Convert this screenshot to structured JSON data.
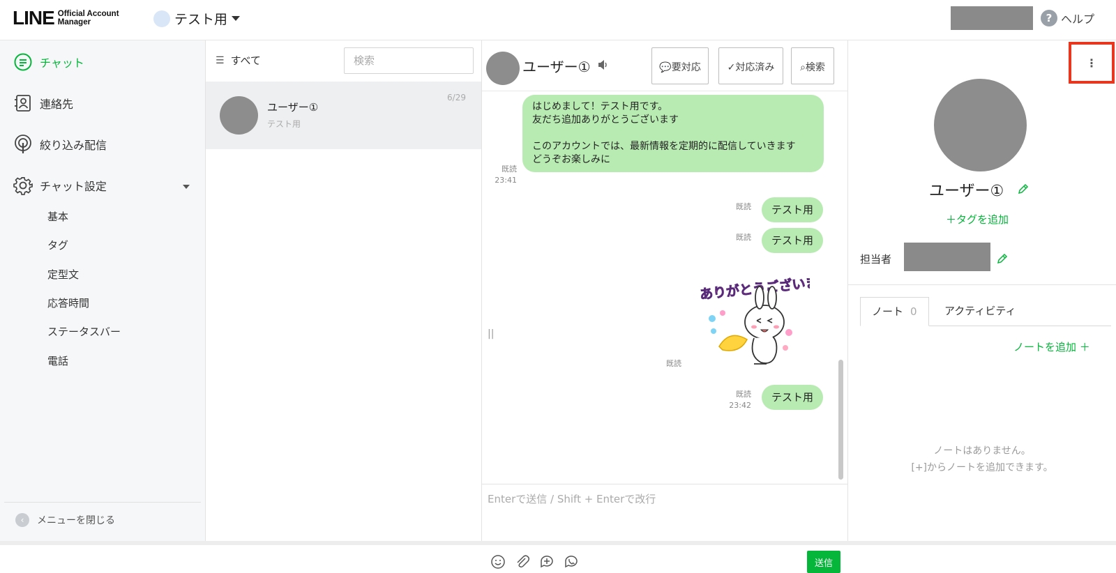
{
  "header": {
    "logo_main": "LINE",
    "logo_sub_line1": "Official Account",
    "logo_sub_line2": "Manager",
    "account_name": "テスト用",
    "help_label": "ヘルプ"
  },
  "sidebar": {
    "items": [
      {
        "label": "チャット",
        "icon": "chat-icon",
        "active": true
      },
      {
        "label": "連絡先",
        "icon": "contacts-icon"
      },
      {
        "label": "絞り込み配信",
        "icon": "broadcast-icon"
      },
      {
        "label": "チャット設定",
        "icon": "gear-icon"
      }
    ],
    "sub_items": [
      "基本",
      "タグ",
      "定型文",
      "応答時間",
      "ステータスバー",
      "電話"
    ],
    "close_menu": "メニューを閉じる"
  },
  "chat_list": {
    "filter_label": "すべて",
    "search_placeholder": "検索",
    "rows": [
      {
        "name": "ユーザー①",
        "preview": "テスト用",
        "date": "6/29"
      }
    ]
  },
  "conversation": {
    "user_name": "ユーザー①",
    "buttons": {
      "needs_action": "要対応",
      "done": "対応済み",
      "search": "検索"
    },
    "messages": [
      {
        "text": "はじめまして！テスト用です。\n友だち追加ありがとうございます\n\nこのアカウントでは、最新情報を定期的に配信していきます\nどうぞお楽しみに",
        "read": "既読",
        "time": "23:41"
      },
      {
        "text": "テスト用",
        "read": "既読",
        "time": ""
      },
      {
        "text": "テスト用",
        "read": "既読",
        "time": ""
      },
      {
        "sticker": "ありがとうございます!",
        "read": "既読",
        "time": ""
      },
      {
        "text": "テスト用",
        "read": "既読",
        "time": "23:42"
      }
    ],
    "composer_placeholder": "Enterで送信 / Shift + Enterで改行",
    "send_label": "送信"
  },
  "profile": {
    "more_label": "⋮",
    "name": "ユーザー①",
    "add_tag": "＋タグを追加",
    "assignee_label": "担当者",
    "tabs": [
      {
        "label": "ノート",
        "count": "0",
        "active": true
      },
      {
        "label": "アクティビティ"
      }
    ],
    "add_note": "ノートを追加 ＋",
    "empty_line1": "ノートはありません。",
    "empty_line2": "[+]からノートを追加できます。"
  },
  "colors": {
    "brand_green": "#06b63b",
    "bubble_green": "#b8ebb2",
    "highlight_red": "#e8371f"
  }
}
